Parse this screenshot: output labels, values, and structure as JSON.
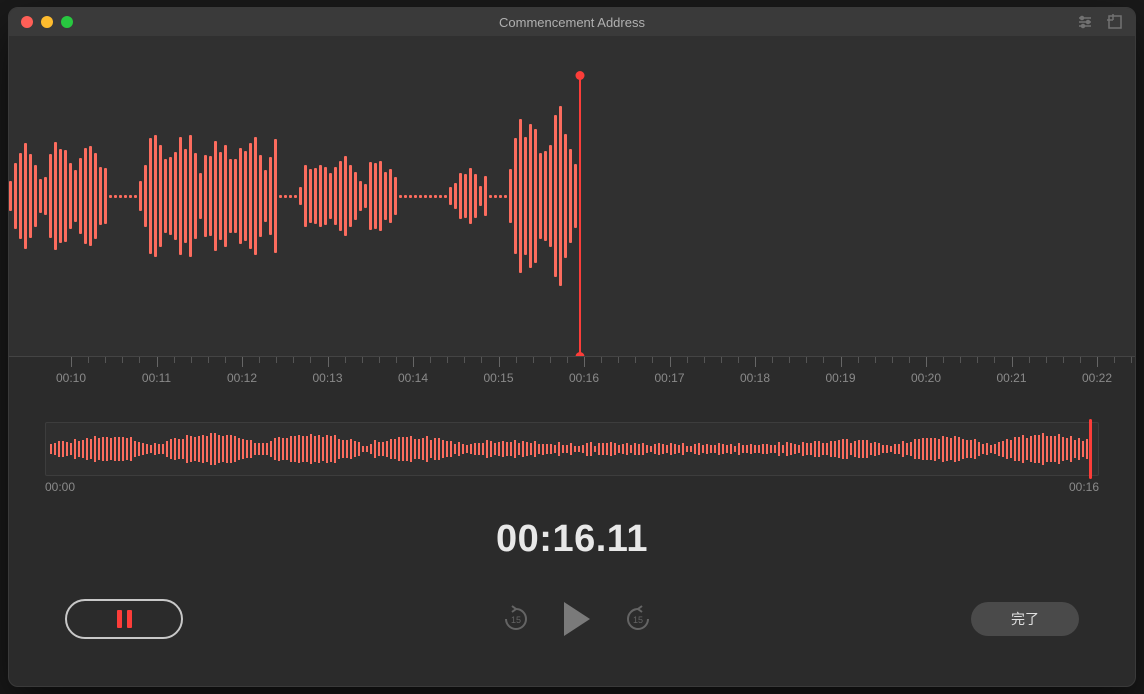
{
  "window": {
    "title": "Commencement Address"
  },
  "ruler": {
    "labels": [
      "00:10",
      "00:11",
      "00:12",
      "00:13",
      "00:14",
      "00:15",
      "00:16",
      "00:17",
      "00:18",
      "00:19",
      "00:20",
      "00:21",
      "00:22"
    ]
  },
  "overview": {
    "start": "00:00",
    "end": "00:16"
  },
  "time_display": "00:16.11",
  "skip": {
    "back_seconds": "15",
    "forward_seconds": "15"
  },
  "buttons": {
    "done_label": "完了"
  },
  "colors": {
    "accent": "#fc3d39",
    "waveform": "#fc6c5e"
  }
}
